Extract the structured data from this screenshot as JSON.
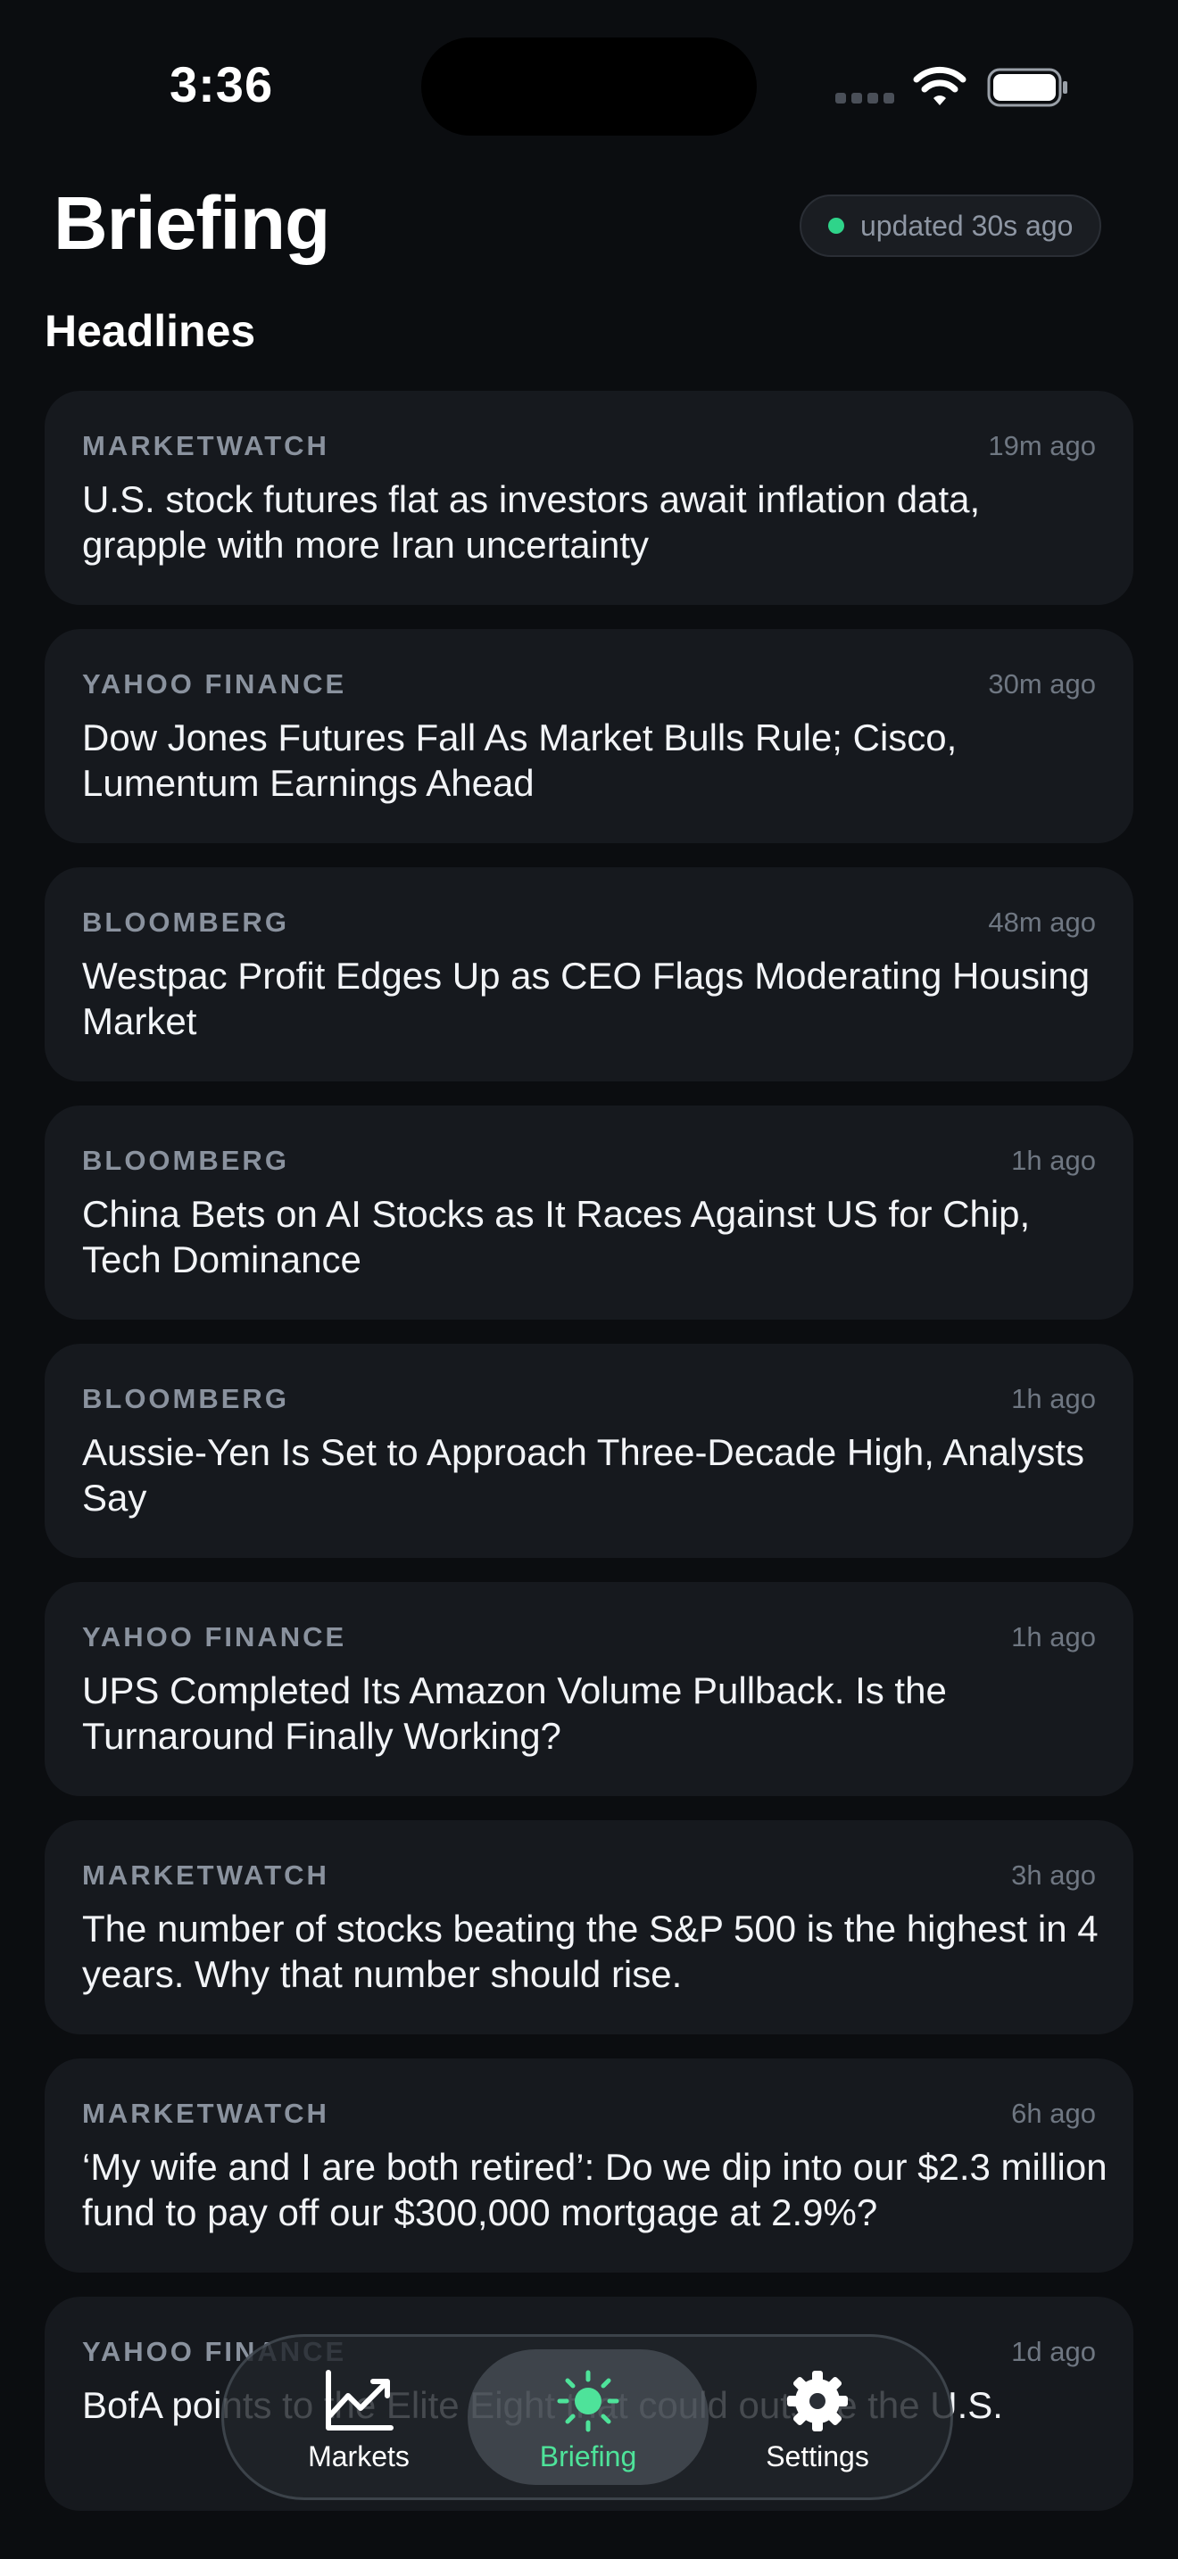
{
  "status_bar": {
    "time": "3:36"
  },
  "header": {
    "title": "Briefing",
    "updated_label": "updated 30s ago"
  },
  "section": {
    "title": "Headlines"
  },
  "headlines": [
    {
      "source": "MARKETWATCH",
      "time": "19m ago",
      "headline": "U.S. stock futures flat as investors await inflation data, grapple with more Iran uncertainty"
    },
    {
      "source": "YAHOO FINANCE",
      "time": "30m ago",
      "headline": "Dow Jones Futures Fall As Market Bulls Rule; Cisco, Lumentum Earnings Ahead"
    },
    {
      "source": "BLOOMBERG",
      "time": "48m ago",
      "headline": "Westpac Profit Edges Up as CEO Flags Moderating Housing Market"
    },
    {
      "source": "BLOOMBERG",
      "time": "1h ago",
      "headline": "China Bets on AI Stocks as It Races Against US for Chip, Tech Dominance"
    },
    {
      "source": "BLOOMBERG",
      "time": "1h ago",
      "headline": "Aussie-Yen Is Set to Approach Three-Decade High, Analysts Say"
    },
    {
      "source": "YAHOO FINANCE",
      "time": "1h ago",
      "headline": "UPS Completed Its Amazon Volume Pullback. Is the Turnaround Finally Working?"
    },
    {
      "source": "MARKETWATCH",
      "time": "3h ago",
      "headline": "The number of stocks beating the S&P 500 is the highest in 4 years. Why that number should rise."
    },
    {
      "source": "MARKETWATCH",
      "time": "6h ago",
      "headline": "‘My wife and I are both retired’: Do we dip into our $2.3 million fund to pay off our $300,000 mortgage at 2.9%?"
    },
    {
      "source": "YAHOO FINANCE",
      "time": "1d ago",
      "headline": "BofA points to the Elite Eight that could outsize the U.S."
    }
  ],
  "tab_bar": {
    "tabs": [
      {
        "label": "Markets",
        "icon": "chart-line-icon",
        "active": false
      },
      {
        "label": "Briefing",
        "icon": "sun-icon",
        "active": true
      },
      {
        "label": "Settings",
        "icon": "gear-icon",
        "active": false
      }
    ]
  },
  "colors": {
    "background": "#0b0d10",
    "card": "#16191e",
    "accent_green": "#4ee39a",
    "live_dot": "#2fd48a"
  }
}
